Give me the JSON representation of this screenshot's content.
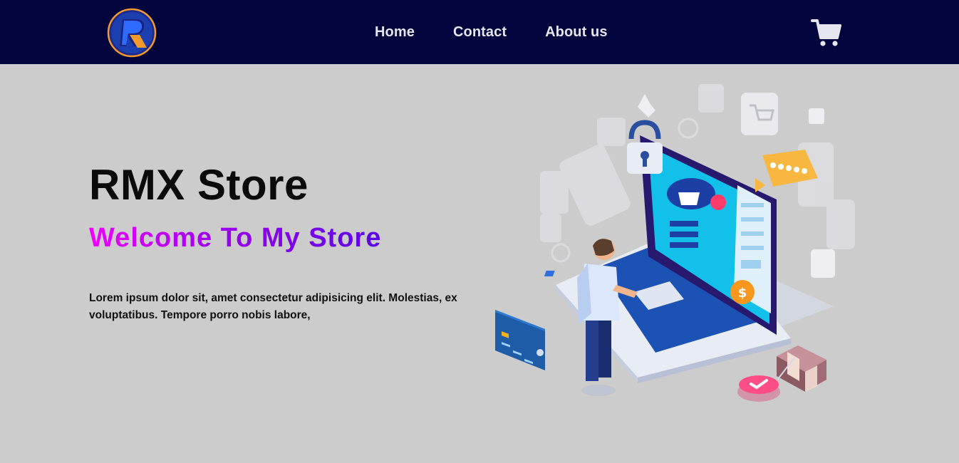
{
  "nav": {
    "logo_icon": "rmx-logo-icon",
    "links": [
      {
        "label": "Home"
      },
      {
        "label": "Contact"
      },
      {
        "label": "About us"
      }
    ],
    "cart_icon": "shopping-cart-icon"
  },
  "hero": {
    "title": "RMX Store",
    "subtitle": "Welcome To My Store",
    "description": "Lorem ipsum dolor sit, amet consectetur adipisicing elit. Molestias, ex voluptatibus. Tempore porro nobis labore,",
    "illustration": "online-shopping-illustration",
    "price_badge": "$"
  },
  "colors": {
    "navbar": "#01033d",
    "background": "#cccccc",
    "gradient_start": "#ee00ff",
    "gradient_end": "#5a08e6",
    "logo_ring": "#f39a2b"
  }
}
